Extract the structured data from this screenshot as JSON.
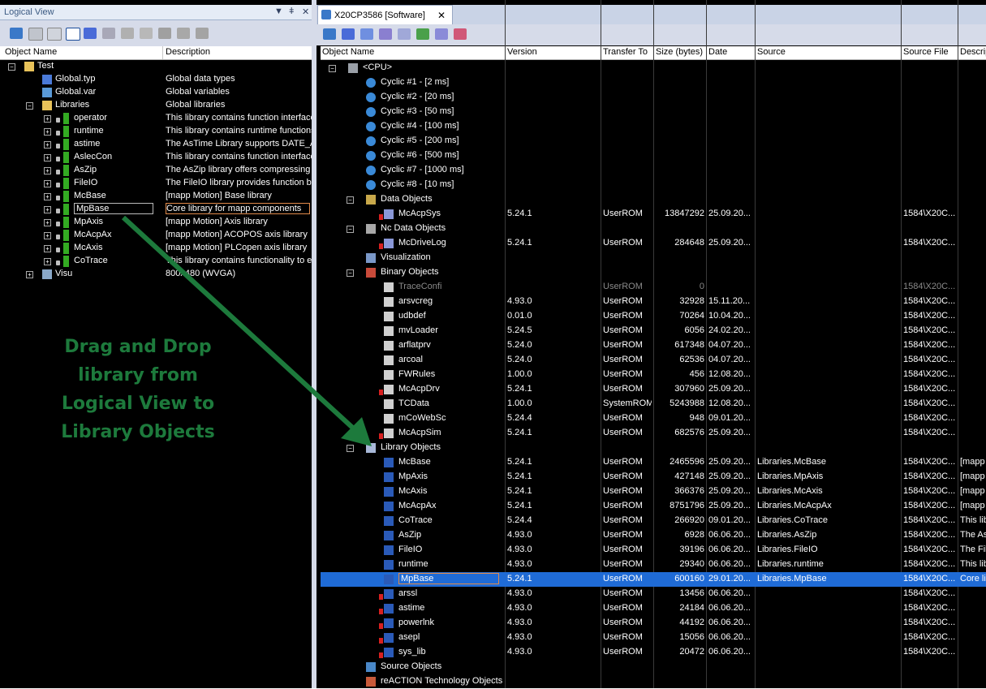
{
  "left": {
    "title": "Logical View",
    "controls": [
      "▼",
      "ǂ",
      "✕"
    ],
    "col_name": "Object Name",
    "col_desc": "Description",
    "tree": [
      {
        "name": "Test",
        "desc": "",
        "level": 0,
        "icon": "folder",
        "toggle": "−"
      },
      {
        "name": "Global.typ",
        "desc": "Global data types",
        "level": 1,
        "icon": "typ-file"
      },
      {
        "name": "Global.var",
        "desc": "Global variables",
        "level": 1,
        "icon": "var-file"
      },
      {
        "name": "Libraries",
        "desc": "Global libraries",
        "level": 1,
        "icon": "folder",
        "toggle": "−"
      },
      {
        "name": "operator",
        "desc": "This library contains function interface",
        "level": 2,
        "icon": "lib",
        "toggle": "+"
      },
      {
        "name": "runtime",
        "desc": "This library contains runtime functions",
        "level": 2,
        "icon": "lib",
        "toggle": "+"
      },
      {
        "name": "astime",
        "desc": "The AsTime Library supports DATE_A",
        "level": 2,
        "icon": "lib",
        "toggle": "+"
      },
      {
        "name": "AslecCon",
        "desc": "This library contains function interface",
        "level": 2,
        "icon": "lib",
        "toggle": "+"
      },
      {
        "name": "AsZip",
        "desc": "The AsZip library offers compressing a",
        "level": 2,
        "icon": "lib",
        "toggle": "+"
      },
      {
        "name": "FileIO",
        "desc": "The FileIO library provides function blo",
        "level": 2,
        "icon": "lib",
        "toggle": "+"
      },
      {
        "name": "McBase",
        "desc": "[mapp Motion] Base library",
        "level": 2,
        "icon": "lib",
        "toggle": "+"
      },
      {
        "name": "MpBase",
        "desc": "Core library for mapp components",
        "level": 2,
        "icon": "lib",
        "toggle": "+",
        "selected": true
      },
      {
        "name": "MpAxis",
        "desc": "[mapp Motion] Axis library",
        "level": 2,
        "icon": "lib",
        "toggle": "+"
      },
      {
        "name": "McAcpAx",
        "desc": "[mapp Motion] ACOPOS axis library",
        "level": 2,
        "icon": "lib",
        "toggle": "+"
      },
      {
        "name": "McAxis",
        "desc": "[mapp Motion] PLCopen axis library",
        "level": 2,
        "icon": "lib",
        "toggle": "+"
      },
      {
        "name": "CoTrace",
        "desc": "This library contains functionality to ex",
        "level": 2,
        "icon": "lib",
        "toggle": "+"
      },
      {
        "name": "Visu",
        "desc": "800x480 (WVGA)",
        "level": 1,
        "icon": "monitor",
        "toggle": "+"
      }
    ]
  },
  "right": {
    "tab_title": "X20CP3586 [Software]",
    "tab_close": "✕",
    "columns": [
      "Object Name",
      "Version",
      "Transfer To",
      "Size (bytes)",
      "Date",
      "Source",
      "Source File",
      "Descrip"
    ],
    "rows": [
      {
        "name": "<CPU>",
        "level": 0,
        "icon": "cpu",
        "toggle": "−"
      },
      {
        "name": "Cyclic #1 - [2 ms]",
        "level": 1,
        "icon": "cyclic"
      },
      {
        "name": "Cyclic #2 - [20 ms]",
        "level": 1,
        "icon": "cyclic"
      },
      {
        "name": "Cyclic #3 - [50 ms]",
        "level": 1,
        "icon": "cyclic"
      },
      {
        "name": "Cyclic #4 - [100 ms]",
        "level": 1,
        "icon": "cyclic"
      },
      {
        "name": "Cyclic #5 - [200 ms]",
        "level": 1,
        "icon": "cyclic"
      },
      {
        "name": "Cyclic #6 - [500 ms]",
        "level": 1,
        "icon": "cyclic"
      },
      {
        "name": "Cyclic #7 - [1000 ms]",
        "level": 1,
        "icon": "cyclic"
      },
      {
        "name": "Cyclic #8 - [10 ms]",
        "level": 1,
        "icon": "cyclic"
      },
      {
        "name": "Data Objects",
        "level": 1,
        "icon": "data-folder",
        "toggle": "−"
      },
      {
        "name": "McAcpSys",
        "version": "5.24.1",
        "transfer": "UserROM",
        "size": "13847292",
        "date": "25.09.20...",
        "source": "",
        "sourcefile": "1584\\X20C...",
        "desc": "",
        "level": 2,
        "icon": "obj-red"
      },
      {
        "name": "Nc Data Objects",
        "level": 1,
        "icon": "gear",
        "toggle": "−"
      },
      {
        "name": "McDriveLog",
        "version": "5.24.1",
        "transfer": "UserROM",
        "size": "284648",
        "date": "25.09.20...",
        "source": "",
        "sourcefile": "1584\\X20C...",
        "desc": "",
        "level": 2,
        "icon": "obj-red"
      },
      {
        "name": "Visualization",
        "level": 1,
        "icon": "monitor"
      },
      {
        "name": "Binary Objects",
        "level": 1,
        "icon": "binary",
        "toggle": "−"
      },
      {
        "name": "TraceConfi",
        "version": "",
        "transfer": "UserROM",
        "size": "0",
        "date": "",
        "source": "",
        "sourcefile": "1584\\X20C...",
        "desc": "",
        "level": 2,
        "icon": "bin",
        "dim": true
      },
      {
        "name": "arsvcreg",
        "version": "4.93.0",
        "transfer": "UserROM",
        "size": "32928",
        "date": "15.11.20...",
        "source": "",
        "sourcefile": "1584\\X20C...",
        "desc": "",
        "level": 2,
        "icon": "bin"
      },
      {
        "name": "udbdef",
        "version": "0.01.0",
        "transfer": "UserROM",
        "size": "70264",
        "date": "10.04.20...",
        "source": "",
        "sourcefile": "1584\\X20C...",
        "desc": "",
        "level": 2,
        "icon": "bin"
      },
      {
        "name": "mvLoader",
        "version": "5.24.5",
        "transfer": "UserROM",
        "size": "6056",
        "date": "24.02.20...",
        "source": "",
        "sourcefile": "1584\\X20C...",
        "desc": "",
        "level": 2,
        "icon": "bin"
      },
      {
        "name": "arflatprv",
        "version": "5.24.0",
        "transfer": "UserROM",
        "size": "617348",
        "date": "04.07.20...",
        "source": "",
        "sourcefile": "1584\\X20C...",
        "desc": "",
        "level": 2,
        "icon": "bin"
      },
      {
        "name": "arcoal",
        "version": "5.24.0",
        "transfer": "UserROM",
        "size": "62536",
        "date": "04.07.20...",
        "source": "",
        "sourcefile": "1584\\X20C...",
        "desc": "",
        "level": 2,
        "icon": "bin"
      },
      {
        "name": "FWRules",
        "version": "1.00.0",
        "transfer": "UserROM",
        "size": "456",
        "date": "12.08.20...",
        "source": "",
        "sourcefile": "1584\\X20C...",
        "desc": "",
        "level": 2,
        "icon": "bin"
      },
      {
        "name": "McAcpDrv",
        "version": "5.24.1",
        "transfer": "UserROM",
        "size": "307960",
        "date": "25.09.20...",
        "source": "",
        "sourcefile": "1584\\X20C...",
        "desc": "",
        "level": 2,
        "icon": "bin-red"
      },
      {
        "name": "TCData",
        "version": "1.00.0",
        "transfer": "SystemROM",
        "size": "5243988",
        "date": "12.08.20...",
        "source": "",
        "sourcefile": "1584\\X20C...",
        "desc": "",
        "level": 2,
        "icon": "bin"
      },
      {
        "name": "mCoWebSc",
        "version": "5.24.4",
        "transfer": "UserROM",
        "size": "948",
        "date": "09.01.20...",
        "source": "",
        "sourcefile": "1584\\X20C...",
        "desc": "",
        "level": 2,
        "icon": "bin"
      },
      {
        "name": "McAcpSim",
        "version": "5.24.1",
        "transfer": "UserROM",
        "size": "682576",
        "date": "25.09.20...",
        "source": "",
        "sourcefile": "1584\\X20C...",
        "desc": "",
        "level": 2,
        "icon": "bin-red"
      },
      {
        "name": "Library Objects",
        "level": 1,
        "icon": "lib-folder",
        "toggle": "−"
      },
      {
        "name": "McBase",
        "version": "5.24.1",
        "transfer": "UserROM",
        "size": "2465596",
        "date": "25.09.20...",
        "source": "Libraries.McBase",
        "sourcefile": "1584\\X20C...",
        "desc": "[mapp l",
        "level": 2,
        "icon": "libobj"
      },
      {
        "name": "MpAxis",
        "version": "5.24.1",
        "transfer": "UserROM",
        "size": "427148",
        "date": "25.09.20...",
        "source": "Libraries.MpAxis",
        "sourcefile": "1584\\X20C...",
        "desc": "[mapp l",
        "level": 2,
        "icon": "libobj"
      },
      {
        "name": "McAxis",
        "version": "5.24.1",
        "transfer": "UserROM",
        "size": "366376",
        "date": "25.09.20...",
        "source": "Libraries.McAxis",
        "sourcefile": "1584\\X20C...",
        "desc": "[mapp l",
        "level": 2,
        "icon": "libobj"
      },
      {
        "name": "McAcpAx",
        "version": "5.24.1",
        "transfer": "UserROM",
        "size": "8751796",
        "date": "25.09.20...",
        "source": "Libraries.McAcpAx",
        "sourcefile": "1584\\X20C...",
        "desc": "[mapp l",
        "level": 2,
        "icon": "libobj"
      },
      {
        "name": "CoTrace",
        "version": "5.24.4",
        "transfer": "UserROM",
        "size": "266920",
        "date": "09.01.20...",
        "source": "Libraries.CoTrace",
        "sourcefile": "1584\\X20C...",
        "desc": "This libr",
        "level": 2,
        "icon": "libobj"
      },
      {
        "name": "AsZip",
        "version": "4.93.0",
        "transfer": "UserROM",
        "size": "6928",
        "date": "06.06.20...",
        "source": "Libraries.AsZip",
        "sourcefile": "1584\\X20C...",
        "desc": "The As",
        "level": 2,
        "icon": "libobj"
      },
      {
        "name": "FileIO",
        "version": "4.93.0",
        "transfer": "UserROM",
        "size": "39196",
        "date": "06.06.20...",
        "source": "Libraries.FileIO",
        "sourcefile": "1584\\X20C...",
        "desc": "The Fil",
        "level": 2,
        "icon": "libobj"
      },
      {
        "name": "runtime",
        "version": "4.93.0",
        "transfer": "UserROM",
        "size": "29340",
        "date": "06.06.20...",
        "source": "Libraries.runtime",
        "sourcefile": "1584\\X20C...",
        "desc": "This libr",
        "level": 2,
        "icon": "libobj"
      },
      {
        "name": "MpBase",
        "version": "5.24.1",
        "transfer": "UserROM",
        "size": "600160",
        "date": "29.01.20...",
        "source": "Libraries.MpBase",
        "sourcefile": "1584\\X20C...",
        "desc": "Core lib",
        "level": 2,
        "icon": "libobj",
        "selected": true
      },
      {
        "name": "arssl",
        "version": "4.93.0",
        "transfer": "UserROM",
        "size": "13456",
        "date": "06.06.20...",
        "source": "",
        "sourcefile": "1584\\X20C...",
        "desc": "",
        "level": 2,
        "icon": "libobj-red"
      },
      {
        "name": "astime",
        "version": "4.93.0",
        "transfer": "UserROM",
        "size": "24184",
        "date": "06.06.20...",
        "source": "",
        "sourcefile": "1584\\X20C...",
        "desc": "",
        "level": 2,
        "icon": "libobj-red"
      },
      {
        "name": "powerlnk",
        "version": "4.93.0",
        "transfer": "UserROM",
        "size": "44192",
        "date": "06.06.20...",
        "source": "",
        "sourcefile": "1584\\X20C...",
        "desc": "",
        "level": 2,
        "icon": "libobj-red"
      },
      {
        "name": "asepl",
        "version": "4.93.0",
        "transfer": "UserROM",
        "size": "15056",
        "date": "06.06.20...",
        "source": "",
        "sourcefile": "1584\\X20C...",
        "desc": "",
        "level": 2,
        "icon": "libobj-red"
      },
      {
        "name": "sys_lib",
        "version": "4.93.0",
        "transfer": "UserROM",
        "size": "20472",
        "date": "06.06.20...",
        "source": "",
        "sourcefile": "1584\\X20C...",
        "desc": "",
        "level": 2,
        "icon": "libobj-red"
      },
      {
        "name": "Source Objects",
        "level": 1,
        "icon": "source"
      },
      {
        "name": "reACTION Technology Objects",
        "level": 1,
        "icon": "reaction"
      }
    ]
  },
  "annotation": {
    "lines": [
      "Drag and Drop",
      "library from",
      "Logical View to",
      "Library Objects"
    ],
    "color": "#1d7a3c"
  }
}
